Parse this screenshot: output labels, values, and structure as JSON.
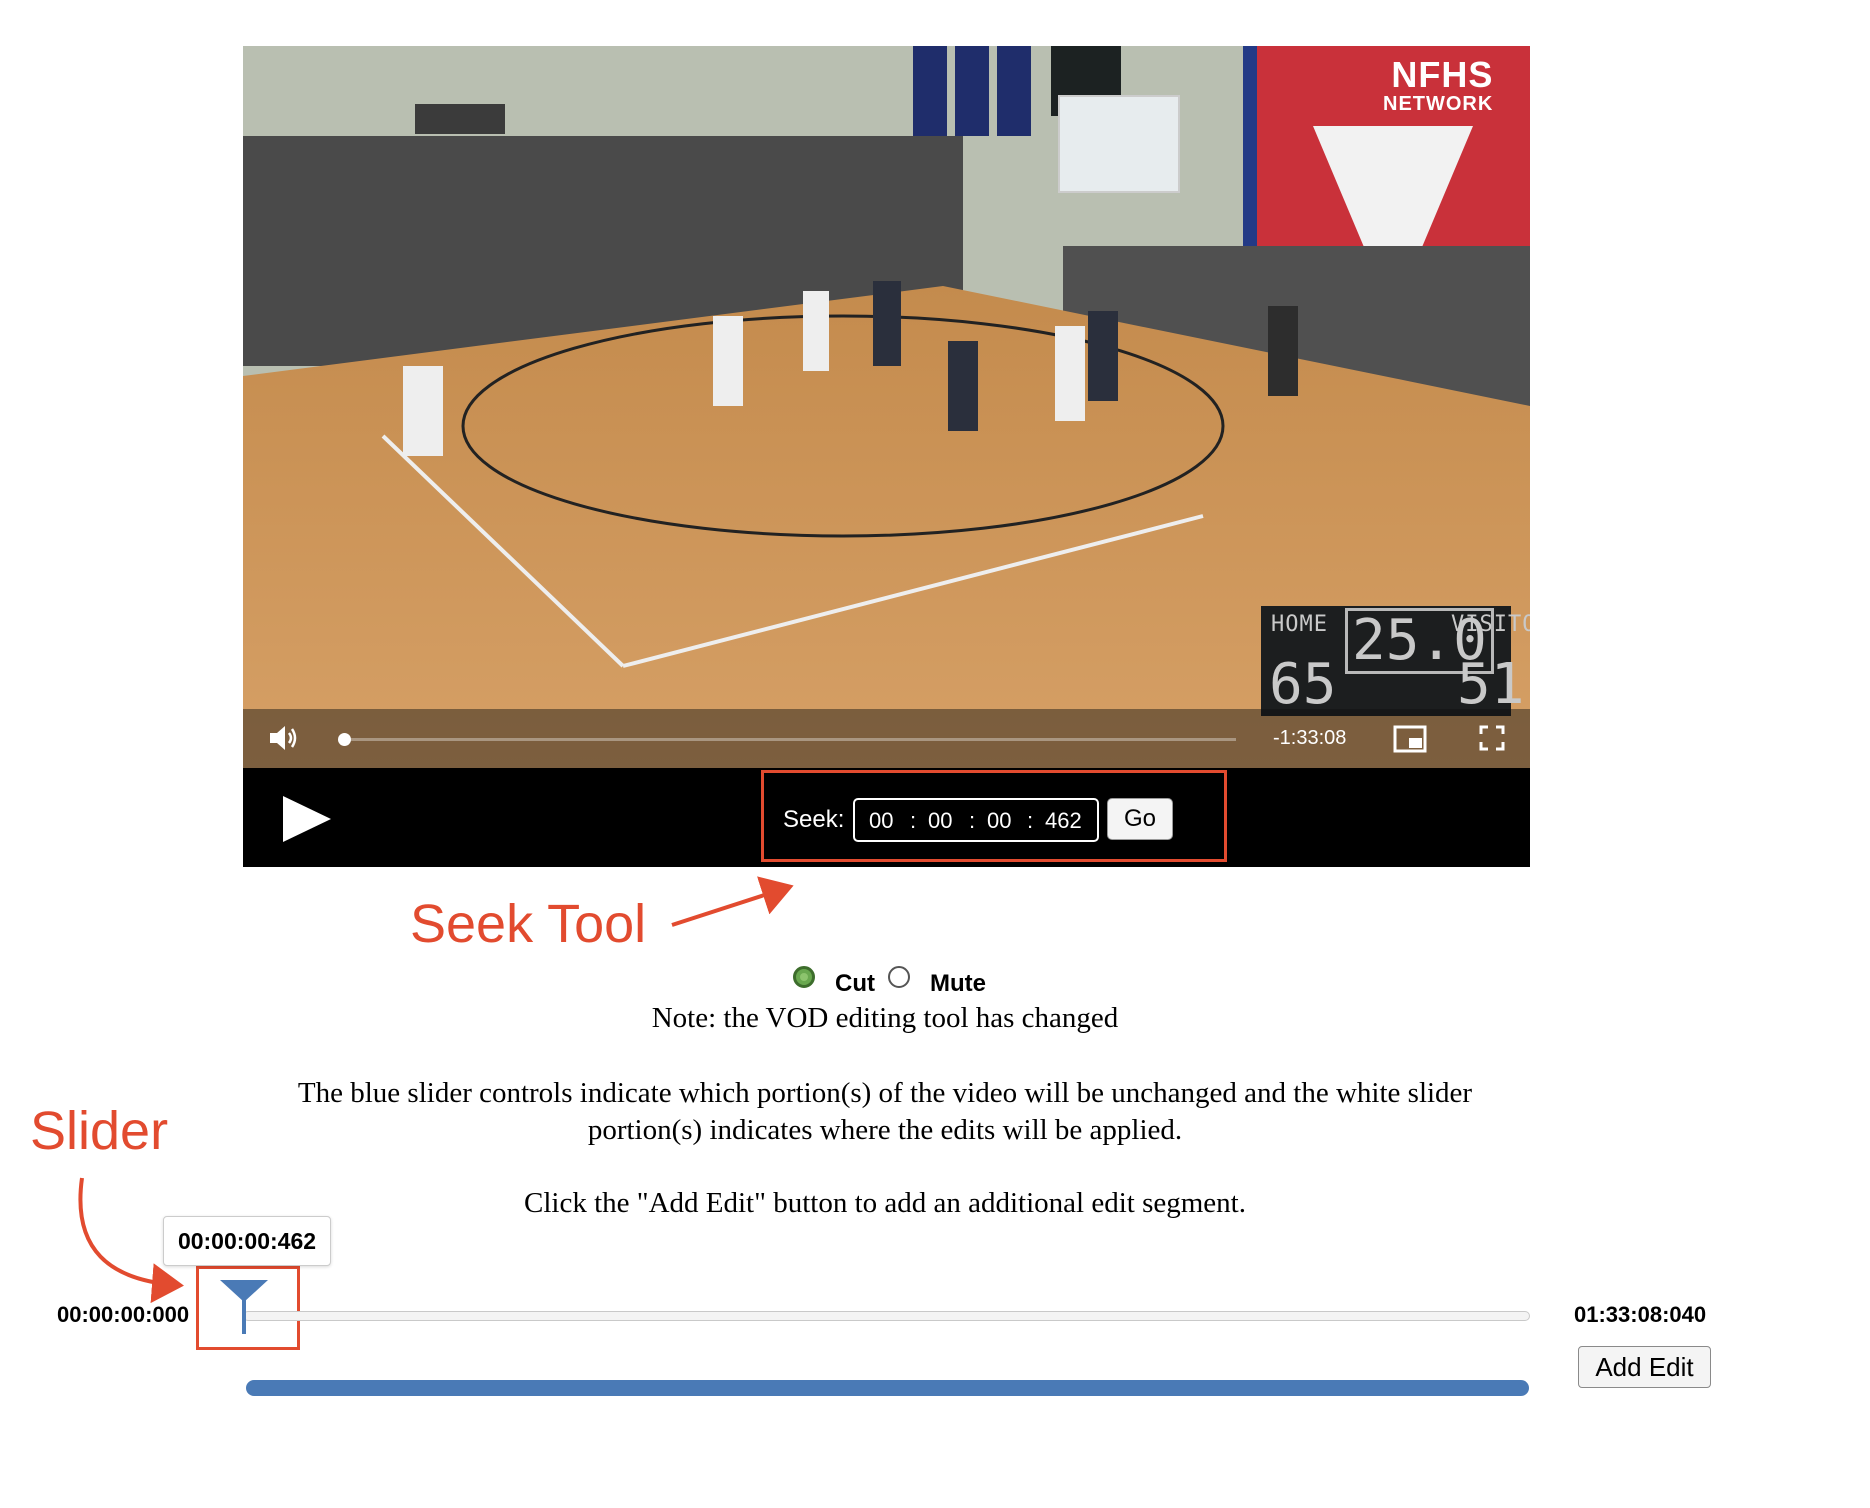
{
  "video": {
    "logo_line1": "NFHS",
    "logo_line2": "NETWORK",
    "remaining_time": "-1:33:08",
    "playback_progress": 0.0,
    "scoreboard": {
      "home_label": "HOME",
      "visitor_label": "VISITOR",
      "clock": "25.0",
      "home_score": "65",
      "visitor_score": "51"
    },
    "icons": {
      "volume": "speaker-icon",
      "pip": "picture-in-picture-icon",
      "fullscreen": "fullscreen-icon",
      "play": "play-icon"
    }
  },
  "seek": {
    "label": "Seek:",
    "hours": "00",
    "minutes": "00",
    "seconds": "00",
    "milliseconds": "462",
    "separator": ":",
    "go_label": "Go"
  },
  "annotations": {
    "seek_tool": "Seek Tool",
    "slider": "Slider",
    "color": "#e24b2f"
  },
  "edit_mode": {
    "options": [
      {
        "label": "Cut",
        "selected": true
      },
      {
        "label": "Mute",
        "selected": false
      }
    ]
  },
  "notes": {
    "note": "Note: the VOD editing tool has changed",
    "slider_info": "The blue slider controls indicate which portion(s) of the video will be unchanged and the white slider portion(s) indicates where the edits will be applied.",
    "add_edit_info": "Click the \"Add Edit\" button to add an additional edit segment."
  },
  "timeline": {
    "start_time": "00:00:00:000",
    "end_time": "01:33:08:040",
    "handle_tooltip": "00:00:00:462",
    "handle_position": 0.0,
    "blue_color": "#4a7ab6",
    "add_edit_label": "Add Edit"
  }
}
